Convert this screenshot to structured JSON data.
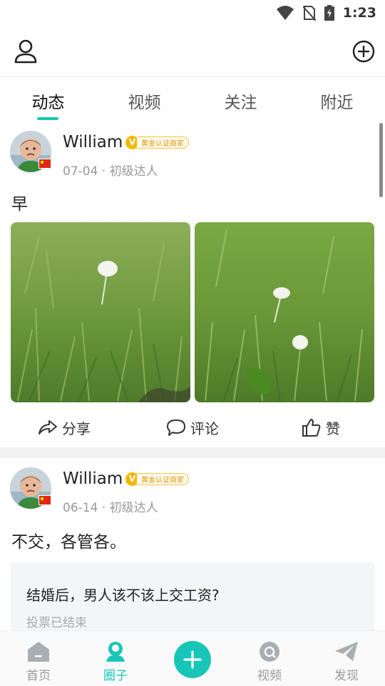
{
  "status_bar": {
    "time": "1:23"
  },
  "header": {
    "profile_icon": "person-icon",
    "add_icon": "plus-circle-icon"
  },
  "tabs": [
    {
      "label": "动态",
      "active": true
    },
    {
      "label": "视频",
      "active": false
    },
    {
      "label": "关注",
      "active": false
    },
    {
      "label": "附近",
      "active": false
    }
  ],
  "posts": [
    {
      "username": "William",
      "badge": "黄金认证商家",
      "badge_letter": "V",
      "meta": "07-04 · 初级达人",
      "text": "早",
      "actions": {
        "share": "分享",
        "comment": "评论",
        "like": "赞"
      }
    },
    {
      "username": "William",
      "badge": "黄金认证商家",
      "badge_letter": "V",
      "meta": "06-14 · 初级达人",
      "text": "不交，各管各。",
      "poll": {
        "question": "结婚后，男人该不该上交工资?",
        "status": "投票已结束"
      }
    }
  ],
  "bottom_nav": {
    "items": [
      {
        "label": "首页",
        "icon": "home-icon",
        "active": false
      },
      {
        "label": "圈子",
        "icon": "circle-group-icon",
        "active": true
      },
      {
        "label": "",
        "icon": "plus-icon",
        "active": false
      },
      {
        "label": "视频",
        "icon": "video-icon",
        "active": false
      },
      {
        "label": "发现",
        "icon": "paper-plane-icon",
        "active": false
      }
    ]
  },
  "colors": {
    "accent": "#18c6b9",
    "badge": "#f5b800",
    "divider": "#f1f1f1"
  }
}
